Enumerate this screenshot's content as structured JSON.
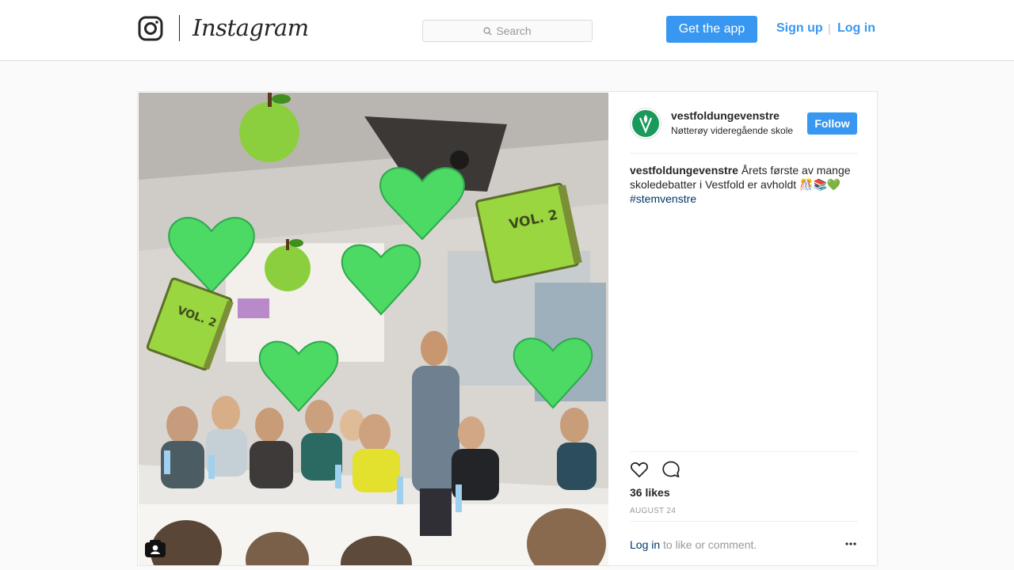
{
  "header": {
    "brand": "Instagram",
    "search_placeholder": "Search",
    "get_app": "Get the app",
    "sign_up": "Sign up",
    "separator": "|",
    "log_in": "Log in"
  },
  "post": {
    "username": "vestfoldungevenstre",
    "location": "Nøtterøy videregående skole",
    "follow": "Follow",
    "caption_user": "vestfoldungevenstre",
    "caption_text": " Årets første av mange skoledebatter i Vestfold er avholdt 🎊📚💚",
    "hashtag": "#stemvenstre",
    "likes": "36 likes",
    "date": "AUGUST 24",
    "login_link": "Log in",
    "login_rest": "to like or comment.",
    "photo_overlay_books": [
      "VOL. 2",
      "VOL. 2"
    ]
  },
  "colors": {
    "accent": "#3897f0",
    "link": "#003569",
    "avatar_green": "#1a9a5a",
    "heart_green": "#4cd964",
    "apple_green": "#8ccf3e"
  },
  "icons": [
    "instagram-glyph-icon",
    "search-icon",
    "tagged-people-icon",
    "heart-outline-icon",
    "comment-icon",
    "more-options-icon"
  ]
}
